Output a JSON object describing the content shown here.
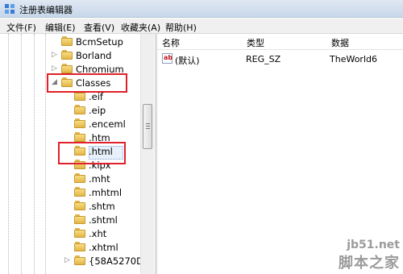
{
  "window": {
    "title": "注册表编辑器"
  },
  "menu": [
    {
      "label": "文件(F)"
    },
    {
      "label": "编辑(E)"
    },
    {
      "label": "查看(V)"
    },
    {
      "label": "收藏夹(A)"
    },
    {
      "label": "帮助(H)"
    }
  ],
  "tree": {
    "items": [
      {
        "label": "BcmSetup",
        "expander": ""
      },
      {
        "label": "Borland",
        "expander": "▷"
      },
      {
        "label": "Chromium",
        "expander": "▷"
      },
      {
        "label": "Classes",
        "expander": "◢"
      },
      {
        "label": ".eif",
        "expander": ""
      },
      {
        "label": ".eip",
        "expander": ""
      },
      {
        "label": ".enceml",
        "expander": ""
      },
      {
        "label": ".htm",
        "expander": ""
      },
      {
        "label": ".html",
        "expander": ""
      },
      {
        "label": ".kipx",
        "expander": ""
      },
      {
        "label": ".mht",
        "expander": ""
      },
      {
        "label": ".mhtml",
        "expander": ""
      },
      {
        "label": ".shtm",
        "expander": ""
      },
      {
        "label": ".shtml",
        "expander": ""
      },
      {
        "label": ".xht",
        "expander": ""
      },
      {
        "label": ".xhtml",
        "expander": ""
      },
      {
        "label": "{58A5270D-7",
        "expander": "▷"
      }
    ],
    "selected": ".html"
  },
  "list": {
    "columns": [
      "名称",
      "类型",
      "数据"
    ],
    "rows": [
      {
        "icon": "ab",
        "name": "(默认)",
        "type": "REG_SZ",
        "data": "TheWorld6"
      }
    ]
  },
  "watermark": {
    "domain": "jb51.net",
    "name": "脚本之家"
  },
  "colors": {
    "highlight_box": "#e0202a",
    "selection": "#e8f0fb"
  }
}
